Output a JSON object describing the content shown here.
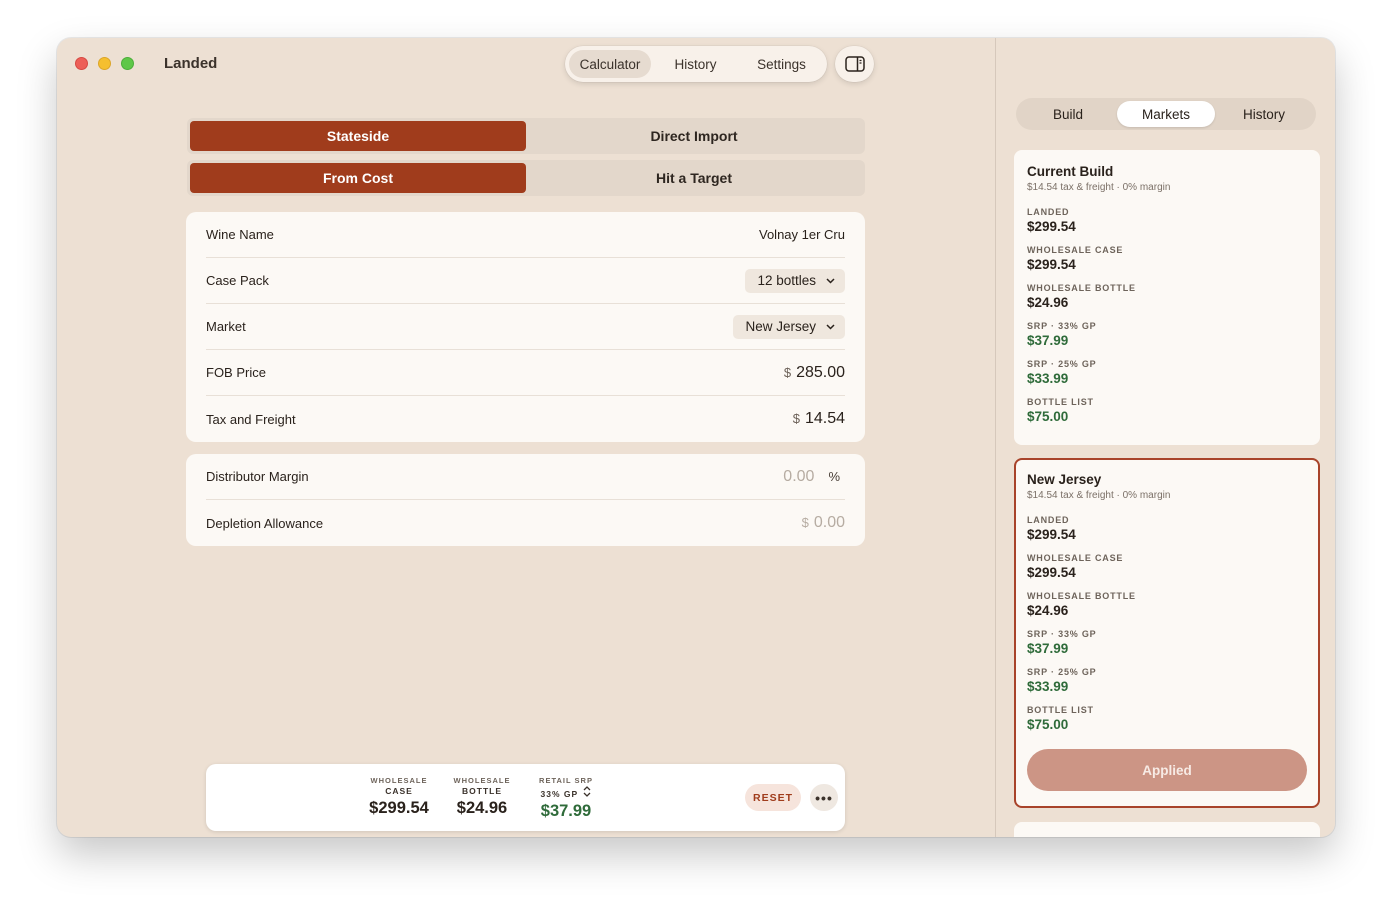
{
  "app": {
    "title": "Landed"
  },
  "toolbar": {
    "tabs": [
      {
        "label": "Calculator",
        "active": true
      },
      {
        "label": "History",
        "active": false
      },
      {
        "label": "Settings",
        "active": false
      }
    ],
    "sidebar_toggle_icon": "sidebar-right-icon"
  },
  "mode": {
    "options": [
      "Stateside",
      "Direct Import"
    ],
    "selected": "Stateside"
  },
  "calc_mode": {
    "options": [
      "From Cost",
      "Hit a Target"
    ],
    "selected": "From Cost"
  },
  "form": {
    "wine_name": {
      "label": "Wine Name",
      "value": "Volnay 1er Cru"
    },
    "case_pack": {
      "label": "Case Pack",
      "value": "12 bottles"
    },
    "market": {
      "label": "Market",
      "value": "New Jersey"
    },
    "fob_price": {
      "label": "FOB Price",
      "currency": "$",
      "value": "285.00"
    },
    "tax_freight": {
      "label": "Tax and Freight",
      "currency": "$",
      "value": "14.54"
    }
  },
  "adjustments": {
    "distributor_margin": {
      "label": "Distributor Margin",
      "value": "0.00",
      "unit": "%"
    },
    "depletion_allowance": {
      "label": "Depletion Allowance",
      "currency": "$",
      "value": "0.00"
    }
  },
  "summary": {
    "wholesale_case": {
      "line1": "WHOLESALE",
      "line2": "CASE",
      "value": "$299.54"
    },
    "wholesale_bottle": {
      "line1": "WHOLESALE",
      "line2": "BOTTLE",
      "value": "$24.96"
    },
    "retail_srp": {
      "line1": "RETAIL SRP",
      "line2": "33% GP",
      "value": "$37.99"
    },
    "reset_label": "RESET",
    "more_label": "•••"
  },
  "sidebar": {
    "tabs": [
      {
        "label": "Build",
        "active": false
      },
      {
        "label": "Markets",
        "active": true
      },
      {
        "label": "History",
        "active": false
      }
    ],
    "cards": [
      {
        "title": "Current Build",
        "subtitle": "$14.54 tax & freight · 0% margin",
        "items": [
          {
            "label": "LANDED",
            "value": "$299.54"
          },
          {
            "label": "WHOLESALE CASE",
            "value": "$299.54"
          },
          {
            "label": "WHOLESALE BOTTLE",
            "value": "$24.96"
          },
          {
            "label": "SRP · 33% GP",
            "value": "$37.99"
          },
          {
            "label": "SRP · 25% GP",
            "value": "$33.99"
          },
          {
            "label": "BOTTLE LIST",
            "value": "$75.00"
          }
        ]
      },
      {
        "title": "New Jersey",
        "subtitle": "$14.54 tax & freight · 0% margin",
        "items": [
          {
            "label": "LANDED",
            "value": "$299.54"
          },
          {
            "label": "WHOLESALE CASE",
            "value": "$299.54"
          },
          {
            "label": "WHOLESALE BOTTLE",
            "value": "$24.96"
          },
          {
            "label": "SRP · 33% GP",
            "value": "$37.99"
          },
          {
            "label": "SRP · 25% GP",
            "value": "$33.99"
          },
          {
            "label": "BOTTLE LIST",
            "value": "$75.00"
          }
        ],
        "button": "Applied"
      }
    ]
  },
  "colors": {
    "accent": "#a03c1c",
    "background": "#ede0d3",
    "card": "#fcf9f5",
    "positive": "#2f6b3a",
    "applied_button": "#cc9585"
  }
}
